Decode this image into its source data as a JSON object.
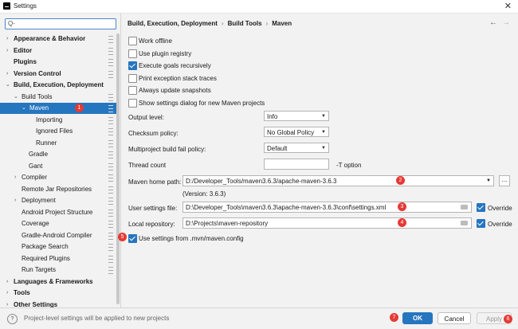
{
  "window": {
    "title": "Settings",
    "close_glyph": "✕"
  },
  "search": {
    "placeholder": "Q-",
    "icon": "search-icon"
  },
  "tree": [
    {
      "label": "Appearance & Behavior"
    },
    {
      "label": "Editor"
    },
    {
      "label": "Plugins"
    },
    {
      "label": "Version Control"
    },
    {
      "label": "Build, Execution, Deployment"
    },
    {
      "label": "Build Tools"
    },
    {
      "label": "Maven"
    },
    {
      "label": "Importing"
    },
    {
      "label": "Ignored Files"
    },
    {
      "label": "Runner"
    },
    {
      "label": "Gradle"
    },
    {
      "label": "Gant"
    },
    {
      "label": "Compiler"
    },
    {
      "label": "Remote Jar Repositories"
    },
    {
      "label": "Deployment"
    },
    {
      "label": "Android Project Structure"
    },
    {
      "label": "Coverage"
    },
    {
      "label": "Gradle-Android Compiler"
    },
    {
      "label": "Package Search"
    },
    {
      "label": "Required Plugins"
    },
    {
      "label": "Run Targets"
    },
    {
      "label": "Languages & Frameworks"
    },
    {
      "label": "Tools"
    },
    {
      "label": "Other Settings"
    }
  ],
  "breadcrumb": {
    "part1": "Build, Execution, Deployment",
    "sep": "›",
    "part2": "Build Tools",
    "part3": "Maven"
  },
  "nav": {
    "back": "←",
    "forward": "→"
  },
  "checkboxes": {
    "work_offline": {
      "label": "Work offline",
      "checked": false
    },
    "plugin_registry": {
      "label": "Use plugin registry",
      "checked": false
    },
    "execute_goals": {
      "label": "Execute goals recursively",
      "checked": true
    },
    "print_trace": {
      "label": "Print exception stack traces",
      "checked": false
    },
    "always_update": {
      "label": "Always update snapshots",
      "checked": false
    },
    "show_dialog": {
      "label": "Show settings dialog for new Maven projects",
      "checked": false
    }
  },
  "fields": {
    "output_level": {
      "label": "Output level:",
      "value": "Info"
    },
    "checksum": {
      "label": "Checksum policy:",
      "value": "No Global Policy"
    },
    "multiproject": {
      "label": "Multiproject build fail policy:",
      "value": "Default"
    },
    "thread_count": {
      "label": "Thread count",
      "value": "",
      "suffix": "-T option"
    },
    "maven_home": {
      "label": "Maven home path:",
      "value": "D:/Developer_Tools/maven3.6.3/apache-maven-3.6.3",
      "version": "(Version: 3.6.3)",
      "browse": "..."
    },
    "user_settings": {
      "label": "User settings file:",
      "value": "D:\\Developer_Tools\\maven3.6.3\\apache-maven-3.6.3\\conf\\settings.xml",
      "override": "Override",
      "override_checked": true
    },
    "local_repo": {
      "label": "Local repository:",
      "value": "D:\\Projects\\maven-repository",
      "override": "Override",
      "override_checked": true
    }
  },
  "mvn_config": {
    "label": "Use settings from .mvn/maven.config",
    "checked": true
  },
  "badges": [
    "1",
    "2",
    "3",
    "4",
    "5",
    "6",
    "7"
  ],
  "footer": {
    "text": "Project-level settings will be applied to new projects",
    "help": "?"
  },
  "buttons": {
    "ok": "OK",
    "cancel": "Cancel",
    "apply": "Apply"
  },
  "colors": {
    "accent": "#2675bf",
    "badge": "#e53935",
    "background": "#f2f2f2"
  }
}
